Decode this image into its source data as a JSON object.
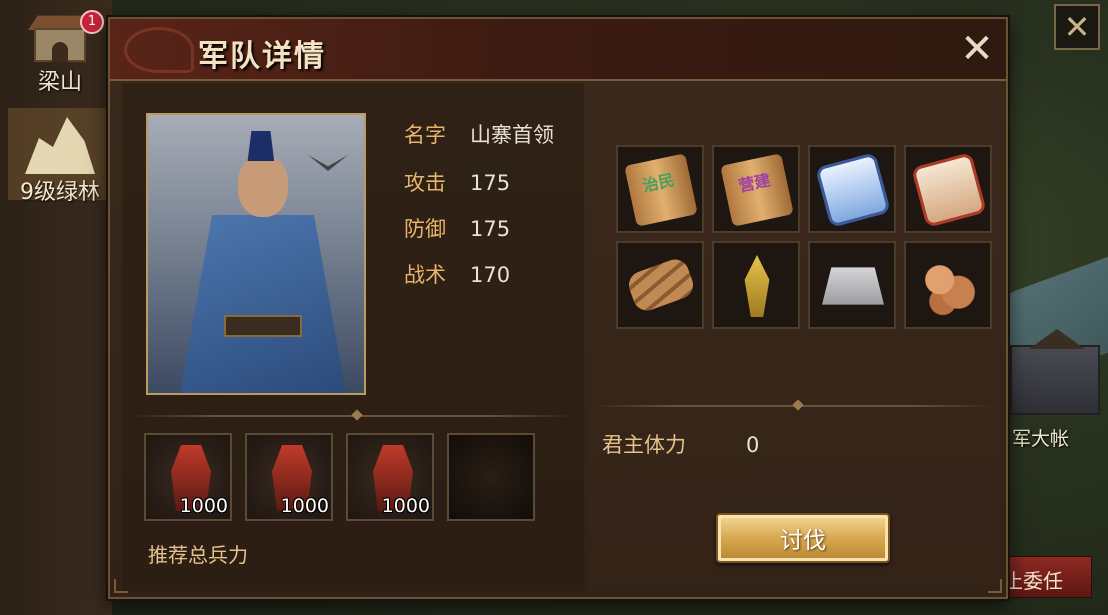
{
  "sidebar": {
    "items": [
      {
        "label": "梁山",
        "badge": "1",
        "icon": "gate-icon"
      },
      {
        "label": "9级绿林",
        "icon": "mountain-icon"
      }
    ]
  },
  "dialog": {
    "title": "军队详情",
    "close_label": "✕"
  },
  "general": {
    "name_label": "名字",
    "name": "山寨首领",
    "attack_label": "攻击",
    "attack": "175",
    "defense_label": "防御",
    "defense": "175",
    "tactics_label": "战术",
    "tactics": "170"
  },
  "troops": [
    {
      "count": "1000",
      "icon": "spearman-icon"
    },
    {
      "count": "1000",
      "icon": "cavalry-icon"
    },
    {
      "count": "1000",
      "icon": "blademan-icon"
    },
    {
      "count": "",
      "icon": "empty-slot"
    }
  ],
  "recommend_label": "推荐总兵力",
  "rewards": [
    {
      "icon": "scroll-icon",
      "text": "治民"
    },
    {
      "icon": "scroll-icon",
      "text": "营建"
    },
    {
      "icon": "blue-scroll-icon",
      "text": ""
    },
    {
      "icon": "red-scroll-icon",
      "text": ""
    },
    {
      "icon": "wood-icon",
      "text": ""
    },
    {
      "icon": "grain-icon",
      "text": ""
    },
    {
      "icon": "iron-ingot-icon",
      "text": ""
    },
    {
      "icon": "copper-coin-icon",
      "text": ""
    }
  ],
  "lord_stamina_label": "君主体力",
  "lord_stamina": "0",
  "attack_button": "讨伐",
  "background": {
    "fort_label": "军大帐",
    "red_button": "止委任"
  }
}
